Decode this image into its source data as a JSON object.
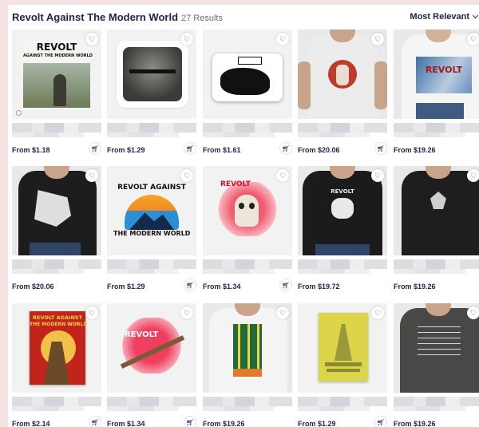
{
  "header": {
    "title": "Revolt Against The Modern World",
    "count": "27 Results",
    "sort_label": "Most Relevant"
  },
  "products": [
    {
      "price": "From $1.18",
      "art": "poster-soldier"
    },
    {
      "price": "From $1.29",
      "art": "sticker-angel"
    },
    {
      "price": "From $1.61",
      "art": "sticker-figure"
    },
    {
      "price": "From $20.06",
      "art": "tshirt-white-red-circle"
    },
    {
      "price": "From $19.26",
      "art": "tshirt-white-revolt"
    },
    {
      "price": "From $20.06",
      "art": "tshirt-black-figure"
    },
    {
      "price": "From $1.29",
      "art": "sticker-mountain"
    },
    {
      "price": "From $1.34",
      "art": "sticker-skull"
    },
    {
      "price": "From $19.72",
      "art": "tshirt-black-revolt"
    },
    {
      "price": "From $19.26",
      "art": "tshirt-black-temple"
    },
    {
      "price": "From $2.14",
      "art": "poster-roman"
    },
    {
      "price": "From $1.34",
      "art": "sticker-rifle"
    },
    {
      "price": "From $19.26",
      "art": "tshirt-white-stripes"
    },
    {
      "price": "From $1.29",
      "art": "poster-yellow"
    },
    {
      "price": "From $19.26",
      "art": "tshirt-grey-text"
    }
  ],
  "art_text": {
    "poster_soldier_l1": "REVOLT",
    "poster_soldier_l2": "AGAINST THE MODERN WORLD",
    "tshirt_white_revolt": "REVOLT",
    "sticker_mountain_top": "REVOLT AGAINST",
    "sticker_mountain_bottom": "THE MODERN WORLD",
    "sticker_skull": "REVOLT",
    "tshirt_black_revolt": "REVOLT",
    "poster_roman_l1": "REVOLT AGAINST",
    "poster_roman_l2": "THE MODERN WORLD",
    "sticker_rifle": "REVOLT"
  },
  "colors": {
    "accent": "#24224a",
    "page_bg": "#f7e3e3",
    "thumb_bg": "#f2f2f2"
  },
  "icons": {
    "favorite": "heart-icon",
    "cart": "add-to-cart-icon",
    "sort": "chevron-down-icon"
  }
}
